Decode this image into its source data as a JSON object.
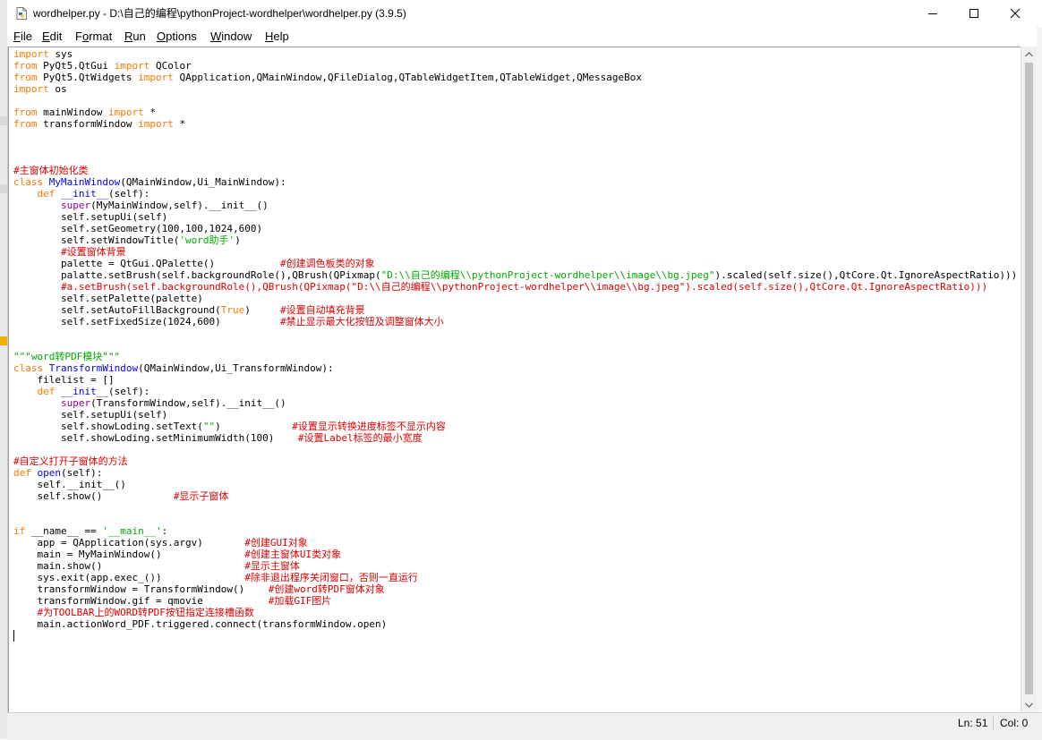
{
  "window": {
    "title": "wordhelper.py - D:\\自己的编程\\pythonProject-wordhelper\\wordhelper.py (3.9.5)"
  },
  "menu": [
    {
      "accel": "F",
      "rest": "ile"
    },
    {
      "accel": "E",
      "rest": "dit"
    },
    {
      "accel": "",
      "pre": "F",
      "u": "o",
      "rest": "rmat"
    },
    {
      "accel": "R",
      "rest": "un"
    },
    {
      "accel": "O",
      "rest": "ptions"
    },
    {
      "accel": "W",
      "rest": "indow"
    },
    {
      "accel": "H",
      "rest": "elp"
    }
  ],
  "colors": {
    "keyword": "#ff7700",
    "builtin": "#900090",
    "definition": "#0000ff",
    "comment": "#dd0000",
    "string": "#00aa00",
    "plain": "#000000"
  },
  "code_lines": [
    [
      [
        "keyword",
        "import"
      ],
      [
        "plain",
        " sys"
      ]
    ],
    [
      [
        "keyword",
        "from"
      ],
      [
        "plain",
        " PyQt5.QtGui "
      ],
      [
        "keyword",
        "import"
      ],
      [
        "plain",
        " QColor"
      ]
    ],
    [
      [
        "keyword",
        "from"
      ],
      [
        "plain",
        " PyQt5.QtWidgets "
      ],
      [
        "keyword",
        "import"
      ],
      [
        "plain",
        " QApplication,QMainWindow,QFileDialog,QTableWidgetItem,QTableWidget,QMessageBox"
      ]
    ],
    [
      [
        "keyword",
        "import"
      ],
      [
        "plain",
        " os"
      ]
    ],
    [],
    [
      [
        "keyword",
        "from"
      ],
      [
        "plain",
        " mainWindow "
      ],
      [
        "keyword",
        "import"
      ],
      [
        "plain",
        " *"
      ]
    ],
    [
      [
        "keyword",
        "from"
      ],
      [
        "plain",
        " transformWindow "
      ],
      [
        "keyword",
        "import"
      ],
      [
        "plain",
        " *"
      ]
    ],
    [],
    [],
    [],
    [
      [
        "comment",
        "#主窗体初始化类"
      ]
    ],
    [
      [
        "keyword",
        "class"
      ],
      [
        "plain",
        " "
      ],
      [
        "definition",
        "MyMainWindow"
      ],
      [
        "plain",
        "(QMainWindow,Ui_MainWindow):"
      ]
    ],
    [
      [
        "plain",
        "    "
      ],
      [
        "keyword",
        "def"
      ],
      [
        "plain",
        " "
      ],
      [
        "definition",
        "__init__"
      ],
      [
        "plain",
        "(self):"
      ]
    ],
    [
      [
        "plain",
        "        "
      ],
      [
        "builtin",
        "super"
      ],
      [
        "plain",
        "(MyMainWindow,self).__init__()"
      ]
    ],
    [
      [
        "plain",
        "        self.setupUi(self)"
      ]
    ],
    [
      [
        "plain",
        "        self.setGeometry(100,100,1024,600)"
      ]
    ],
    [
      [
        "plain",
        "        self.setWindowTitle("
      ],
      [
        "string",
        "'word助手'"
      ],
      [
        "plain",
        ")"
      ]
    ],
    [
      [
        "plain",
        "        "
      ],
      [
        "comment",
        "#设置窗体背景"
      ]
    ],
    [
      [
        "plain",
        "        palette = QtGui.QPalette()           "
      ],
      [
        "comment",
        "#创建调色板类的对象"
      ]
    ],
    [
      [
        "plain",
        "        palatte.setBrush(self.backgroundRole(),QBrush(QPixmap("
      ],
      [
        "string",
        "\"D:\\\\自己的编程\\\\pythonProject-wordhelper\\\\image\\\\bg.jpeg\""
      ],
      [
        "plain",
        ").scaled(self.size(),QtCore.Qt.IgnoreAspectRatio)))"
      ]
    ],
    [
      [
        "plain",
        "        "
      ],
      [
        "comment",
        "#a.setBrush(self.backgroundRole(),QBrush(QPixmap(\"D:\\\\自己的编程\\\\pythonProject-wordhelper\\\\image\\\\bg.jpeg\").scaled(self.size(),QtCore.Qt.IgnoreAspectRatio)))"
      ]
    ],
    [
      [
        "plain",
        "        self.setPalette(palette)"
      ]
    ],
    [
      [
        "plain",
        "        self.setAutoFillBackground("
      ],
      [
        "keyword",
        "True"
      ],
      [
        "plain",
        ")     "
      ],
      [
        "comment",
        "#设置自动填充背景"
      ]
    ],
    [
      [
        "plain",
        "        self.setFixedSize(1024,600)          "
      ],
      [
        "comment",
        "#禁止显示最大化按钮及调整窗体大小"
      ]
    ],
    [],
    [],
    [
      [
        "string",
        "\"\"\"word转PDF模块\"\"\""
      ]
    ],
    [
      [
        "keyword",
        "class"
      ],
      [
        "plain",
        " "
      ],
      [
        "definition",
        "TransformWindow"
      ],
      [
        "plain",
        "(QMainWindow,Ui_TransformWindow):"
      ]
    ],
    [
      [
        "plain",
        "    filelist = []"
      ]
    ],
    [
      [
        "plain",
        "    "
      ],
      [
        "keyword",
        "def"
      ],
      [
        "plain",
        " "
      ],
      [
        "definition",
        "__init__"
      ],
      [
        "plain",
        "(self):"
      ]
    ],
    [
      [
        "plain",
        "        "
      ],
      [
        "builtin",
        "super"
      ],
      [
        "plain",
        "(TransformWindow,self).__init__()"
      ]
    ],
    [
      [
        "plain",
        "        self.setupUi(self)"
      ]
    ],
    [
      [
        "plain",
        "        self.showLoding.setText("
      ],
      [
        "string",
        "\"\""
      ],
      [
        "plain",
        ")            "
      ],
      [
        "comment",
        "#设置显示转换进度标签不显示内容"
      ]
    ],
    [
      [
        "plain",
        "        self.showLoding.setMinimumWidth(100)    "
      ],
      [
        "comment",
        "#设置Label标签的最小宽度"
      ]
    ],
    [],
    [
      [
        "comment",
        "#自定义打开子窗体的方法"
      ]
    ],
    [
      [
        "keyword",
        "def"
      ],
      [
        "plain",
        " "
      ],
      [
        "definition",
        "open"
      ],
      [
        "plain",
        "(self):"
      ]
    ],
    [
      [
        "plain",
        "    self.__init__()"
      ]
    ],
    [
      [
        "plain",
        "    self.show()            "
      ],
      [
        "comment",
        "#显示子窗体"
      ]
    ],
    [],
    [],
    [
      [
        "keyword",
        "if"
      ],
      [
        "plain",
        " __name__ == "
      ],
      [
        "string",
        "'__main__'"
      ],
      [
        "plain",
        ":"
      ]
    ],
    [
      [
        "plain",
        "    app = QApplication(sys.argv)       "
      ],
      [
        "comment",
        "#创建GUI对象"
      ]
    ],
    [
      [
        "plain",
        "    main = MyMainWindow()              "
      ],
      [
        "comment",
        "#创建主窗体UI类对象"
      ]
    ],
    [
      [
        "plain",
        "    main.show()                        "
      ],
      [
        "comment",
        "#显示主窗体"
      ]
    ],
    [
      [
        "plain",
        "    sys.exit(app.exec_())              "
      ],
      [
        "comment",
        "#除非退出程序关闭窗口，否则一直运行"
      ]
    ],
    [
      [
        "plain",
        "    transformWindow = TransformWindow()    "
      ],
      [
        "comment",
        "#创建word转PDF窗体对象"
      ]
    ],
    [
      [
        "plain",
        "    transformWindow.gif = qmovie           "
      ],
      [
        "comment",
        "#加载GIF图片"
      ]
    ],
    [
      [
        "plain",
        "    "
      ],
      [
        "comment",
        "#为TOOLBAR上的WORD转PDF按钮指定连接槽函数"
      ]
    ],
    [
      [
        "plain",
        "    main.actionWord_PDF.triggered.connect(transformWindow.open)"
      ]
    ],
    []
  ],
  "status": {
    "line": "Ln: 51",
    "col": "Col: 0"
  }
}
